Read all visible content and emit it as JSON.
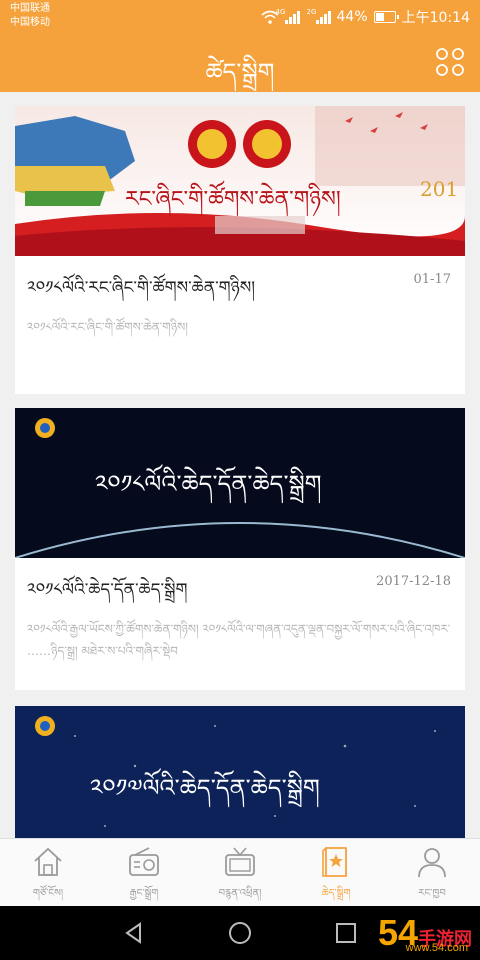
{
  "status": {
    "carrier1": "中国联通",
    "carrier2": "中国移动",
    "net1": "4G",
    "net2": "2G",
    "battery": "44%",
    "time": "上午10:14"
  },
  "header": {
    "title": "ཚེད་སྒྲིག",
    "menu_icon": "grid-menu-icon"
  },
  "articles": [
    {
      "banner_text": "རང་ཞིང་གི་ཚོགས་ཆེན་གཉིས།",
      "banner_year": "201",
      "title": "༢༠༡༨ལོའི་རང་ཞིང་གི་ཚོགས་ཆེན་གཉིས།",
      "date": "01-17",
      "summary": "༢༠༡༨ལོའི་རང་ཞིང་གི་ཚོགས་ཆེན་གཉིས།"
    },
    {
      "banner_text": "༢༠༡༨ལོའི་ཆེད་དོན་ཆེད་སྒྲིག",
      "title": "༢༠༡༨ལོའི་ཆེད་དོན་ཆེད་སྒྲིག",
      "date": "2017-12-18",
      "summary": "༢༠༡༨ལོའི་རྒྱལ་ཡོངས་ཀྱི་ཚོགས་ཆེན་གཉིས། ༢༠༡༨ལོའི་ལ་གཞན་འདུན་ལྡན་བསྐྱར་ལོ་གསར་པའི་ཞིང་འཁར་ ……ཉིད་སྒྲ། མཐེར་ས་པའི་གཞིར་སྡེབ"
    },
    {
      "banner_text": "༢༠༡༧ལོའི་ཆེད་དོན་ཆེད་སྒྲིག"
    }
  ],
  "nav": [
    {
      "label": "གཙོ་ངོས།",
      "icon": "home-icon",
      "active": false
    },
    {
      "label": "རྒྱང་སྒྲོག",
      "icon": "radio-icon",
      "active": false
    },
    {
      "label": "བརྙན་འཕྲིན།",
      "icon": "tv-icon",
      "active": false
    },
    {
      "label": "ཆེད་སྒྲིག",
      "icon": "star-book-icon",
      "active": true
    },
    {
      "label": "རང་ཁྱབ",
      "icon": "user-icon",
      "active": false
    }
  ],
  "watermark": {
    "number": "54",
    "brand": "手游网",
    "url": "www.54.com"
  },
  "colors": {
    "accent": "#f5a23d",
    "nav_inactive": "#9a9a9a"
  }
}
